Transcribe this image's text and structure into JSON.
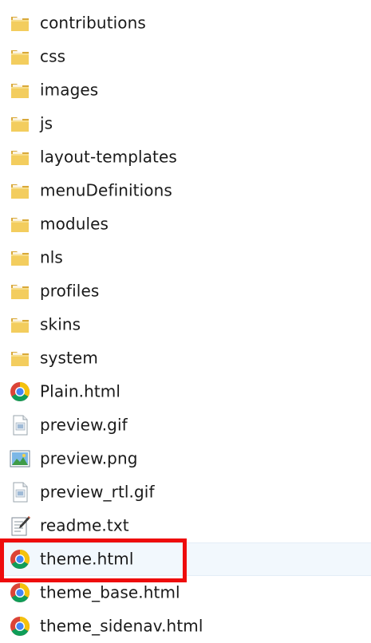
{
  "files": [
    {
      "name": "contributions",
      "type": "folder",
      "icon": "folder-icon"
    },
    {
      "name": "css",
      "type": "folder",
      "icon": "folder-icon"
    },
    {
      "name": "images",
      "type": "folder",
      "icon": "folder-icon"
    },
    {
      "name": "js",
      "type": "folder",
      "icon": "folder-icon"
    },
    {
      "name": "layout-templates",
      "type": "folder",
      "icon": "folder-icon"
    },
    {
      "name": "menuDefinitions",
      "type": "folder",
      "icon": "folder-icon"
    },
    {
      "name": "modules",
      "type": "folder",
      "icon": "folder-icon"
    },
    {
      "name": "nls",
      "type": "folder",
      "icon": "folder-icon"
    },
    {
      "name": "profiles",
      "type": "folder",
      "icon": "folder-icon"
    },
    {
      "name": "skins",
      "type": "folder",
      "icon": "folder-icon"
    },
    {
      "name": "system",
      "type": "folder",
      "icon": "folder-icon"
    },
    {
      "name": "Plain.html",
      "type": "html",
      "icon": "chrome-html-icon"
    },
    {
      "name": "preview.gif",
      "type": "gif",
      "icon": "gif-file-icon"
    },
    {
      "name": "preview.png",
      "type": "png",
      "icon": "image-file-icon"
    },
    {
      "name": "preview_rtl.gif",
      "type": "gif",
      "icon": "gif-file-icon"
    },
    {
      "name": "readme.txt",
      "type": "txt",
      "icon": "text-file-icon"
    },
    {
      "name": "theme.html",
      "type": "html",
      "icon": "chrome-html-icon",
      "highlighted": true
    },
    {
      "name": "theme_base.html",
      "type": "html",
      "icon": "chrome-html-icon"
    },
    {
      "name": "theme_sidenav.html",
      "type": "html",
      "icon": "chrome-html-icon"
    }
  ],
  "colors": {
    "highlight_border": "#ee0c0c",
    "hover_background": "#f2f8fd",
    "text": "#1a1a1a"
  }
}
